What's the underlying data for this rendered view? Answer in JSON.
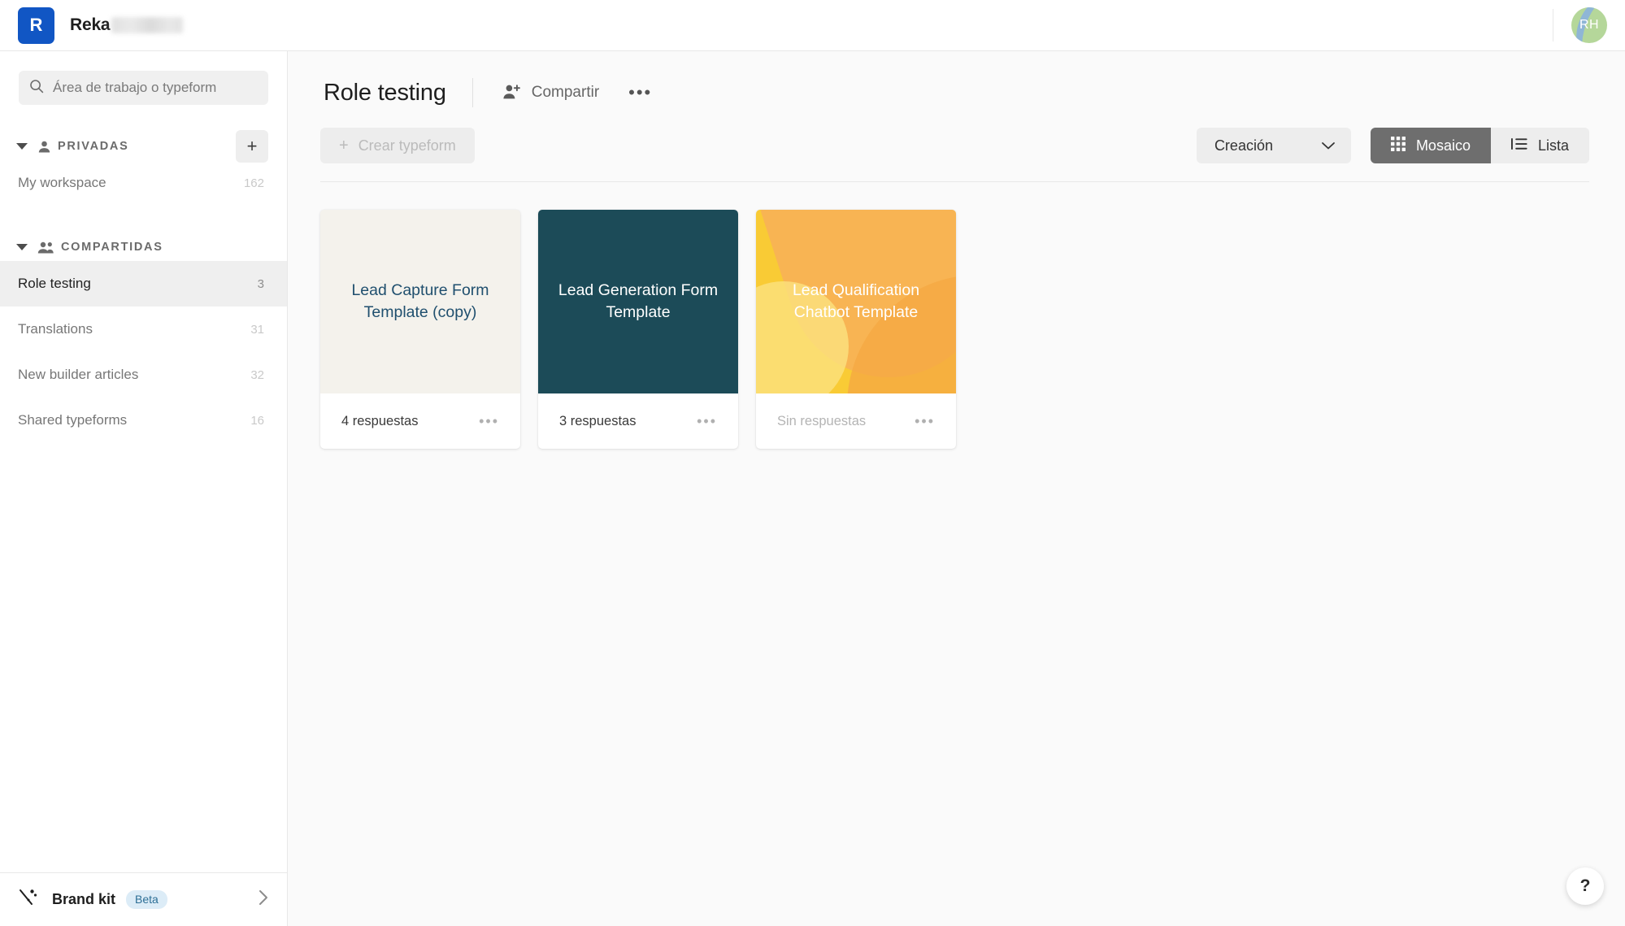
{
  "topbar": {
    "logo_letter": "R",
    "brand_name": "Reka",
    "avatar_initials": "RH"
  },
  "sidebar": {
    "search": {
      "placeholder": "Área de trabajo o typeform",
      "value": ""
    },
    "sections": [
      {
        "title": "PRIVADAS",
        "icon": "person-icon",
        "add_label": "+",
        "items": [
          {
            "label": "My workspace",
            "count": "162",
            "active": false
          }
        ]
      },
      {
        "title": "COMPARTIDAS",
        "icon": "people-icon",
        "items": [
          {
            "label": "Role testing",
            "count": "3",
            "active": true
          },
          {
            "label": "Translations",
            "count": "31",
            "active": false
          },
          {
            "label": "New builder articles",
            "count": "32",
            "active": false
          },
          {
            "label": "Shared typeforms",
            "count": "16",
            "active": false
          }
        ]
      }
    ],
    "brand_kit": {
      "label": "Brand kit",
      "badge": "Beta"
    }
  },
  "main": {
    "page_title": "Role testing",
    "share_label": "Compartir",
    "more_label": "•••",
    "create_label": "Crear typeform",
    "create_plus": "+",
    "sort_label": "Creación",
    "view_tile_label": "Mosaico",
    "view_list_label": "Lista",
    "cards": [
      {
        "title": "Lead Capture Form Template (copy)",
        "responses": "4 respuestas",
        "empty": false,
        "style": "cream",
        "bg": "#f4f2ec",
        "fg": "#1f4f6e",
        "menu": "•••"
      },
      {
        "title": "Lead Generation Form Template",
        "responses": "3 respuestas",
        "empty": false,
        "style": "teal",
        "bg": "#1c4b58",
        "fg": "#ffffff",
        "menu": "•••"
      },
      {
        "title": "Lead Qualification Chatbot Template",
        "responses": "Sin respuestas",
        "empty": true,
        "style": "yellow-art",
        "bg": "#f9cb35",
        "fg": "#ffffff",
        "menu": "•••"
      }
    ],
    "help_label": "?"
  },
  "colors": {
    "brand_blue": "#1156c4",
    "active_row": "#efefef",
    "toggle_active": "#6e6e6e",
    "beta_badge_bg": "#dcecf7",
    "beta_badge_fg": "#2d6f96",
    "canvas": "#fafafa"
  }
}
